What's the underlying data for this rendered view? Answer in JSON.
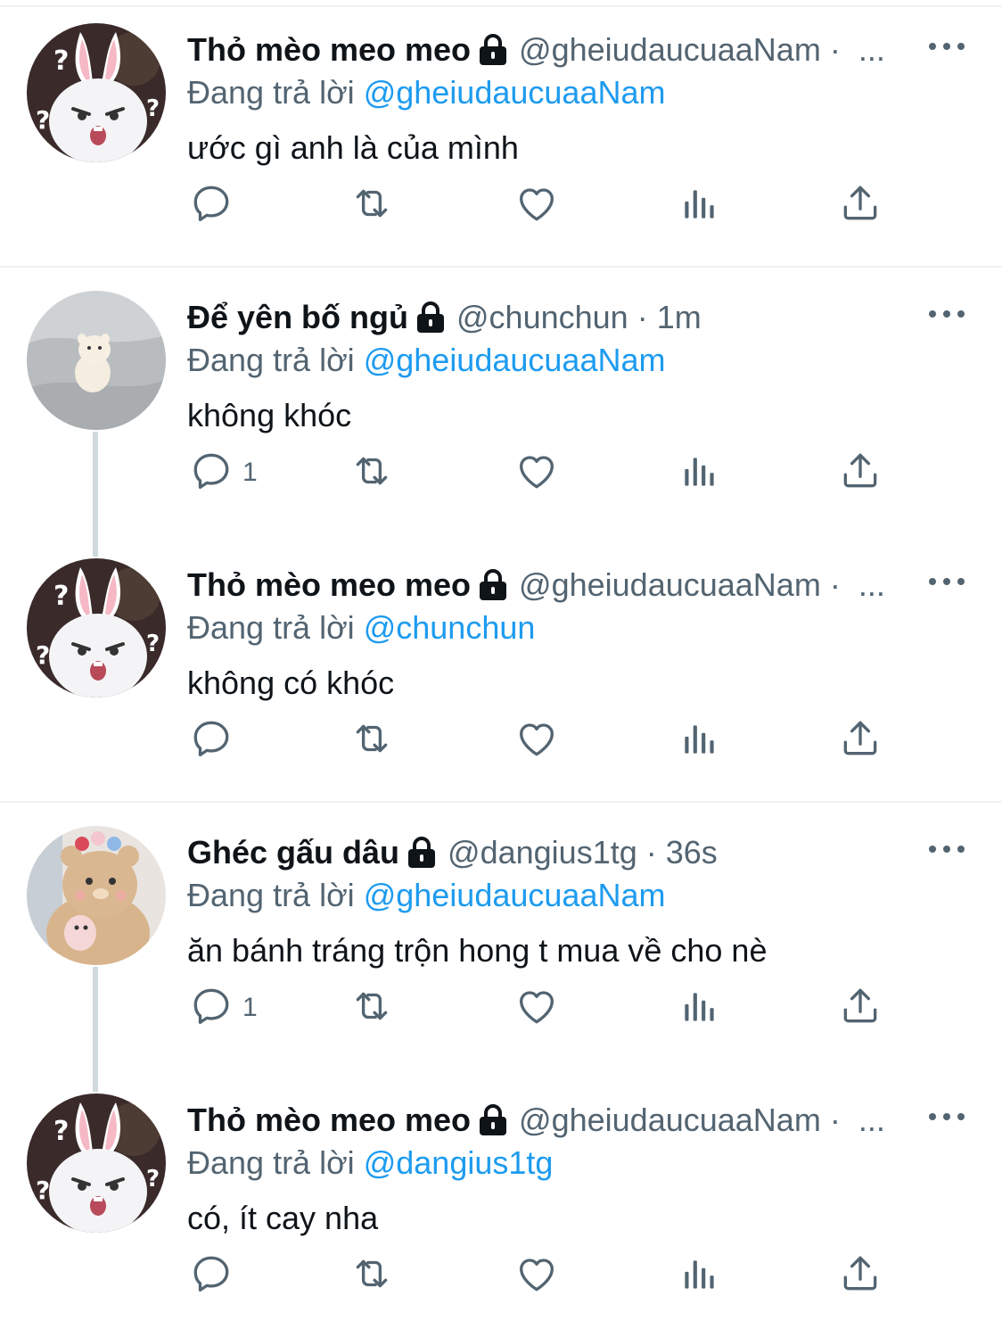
{
  "colors": {
    "text_primary": "#0f1419",
    "text_secondary": "#536471",
    "link": "#1d9bf0",
    "divider": "#eff3f4",
    "thread_line": "#cfd9de"
  },
  "replying_prefix": "Đang trả lời",
  "tweets": [
    {
      "avatar": "bunny-avatar",
      "display_name": "Thỏ mèo meo meo",
      "handle": "@gheiudaucuaaNam",
      "dot": "·",
      "time": "",
      "ellipsis": "...",
      "reply_to": "@gheiudaucuaaNam",
      "text": "ước gì anh là của mình",
      "reply_count": ""
    },
    {
      "avatar": "plush-avatar",
      "display_name": "Để yên bố ngủ",
      "handle": "@chunchun",
      "dot": "·",
      "time": "1m",
      "ellipsis": "",
      "reply_to": "@gheiudaucuaaNam",
      "text": "không khóc",
      "reply_count": "1"
    },
    {
      "avatar": "bunny-avatar",
      "display_name": "Thỏ mèo meo meo",
      "handle": "@gheiudaucuaaNam",
      "dot": "·",
      "time": "",
      "ellipsis": "...",
      "reply_to": "@chunchun",
      "text": "không có khóc",
      "reply_count": ""
    },
    {
      "avatar": "bear-avatar",
      "display_name": "Ghéc gấu dâu",
      "handle": "@dangius1tg",
      "dot": "·",
      "time": "36s",
      "ellipsis": "",
      "reply_to": "@gheiudaucuaaNam",
      "text": "ăn bánh tráng trộn hong t mua về cho nè",
      "reply_count": "1"
    },
    {
      "avatar": "bunny-avatar",
      "display_name": "Thỏ mèo meo meo",
      "handle": "@gheiudaucuaaNam",
      "dot": "·",
      "time": "",
      "ellipsis": "...",
      "reply_to": "@dangius1tg",
      "text": "có, ít cay nha",
      "reply_count": ""
    }
  ]
}
